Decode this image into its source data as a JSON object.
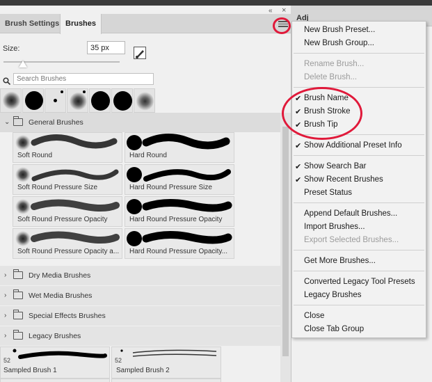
{
  "panel": {
    "tabs": [
      "Brush Settings",
      "Brushes"
    ],
    "size_label": "Size:",
    "size_value": "35 px",
    "size_slider_value": 35,
    "search_placeholder": "Search Brushes"
  },
  "groups": {
    "general": "General Brushes",
    "dry": "Dry Media Brushes",
    "wet": "Wet Media Brushes",
    "special": "Special Effects Brushes",
    "legacy": "Legacy Brushes"
  },
  "brushes": [
    "Soft Round",
    "Hard Round",
    "Soft Round Pressure Size",
    "Hard Round Pressure Size",
    "Soft Round Pressure Opacity",
    "Hard Round Pressure Opacity",
    "Soft Round Pressure Opacity a...",
    "Hard Round Pressure Opacity..."
  ],
  "sampled": {
    "b1_label": "Sampled Brush 1",
    "b1_size": "52",
    "b2_label": "Sampled Brush 2",
    "b2_size": "52"
  },
  "right_tab_label": "Adj",
  "menu": {
    "new_preset": "New Brush Preset...",
    "new_group": "New Brush Group...",
    "rename": "Rename Brush...",
    "delete": "Delete Brush...",
    "brush_name": "Brush Name",
    "brush_stroke": "Brush Stroke",
    "brush_tip": "Brush Tip",
    "show_additional": "Show Additional Preset Info",
    "show_search": "Show Search Bar",
    "show_recent": "Show Recent Brushes",
    "preset_status": "Preset Status",
    "append_default": "Append Default Brushes...",
    "import": "Import Brushes...",
    "export": "Export Selected Brushes...",
    "get_more": "Get More Brushes...",
    "converted": "Converted Legacy Tool Presets",
    "legacy": "Legacy Brushes",
    "close": "Close",
    "close_tab_group": "Close Tab Group",
    "check": "✔"
  },
  "collapse_glyph": "«",
  "close_glyph": "×"
}
